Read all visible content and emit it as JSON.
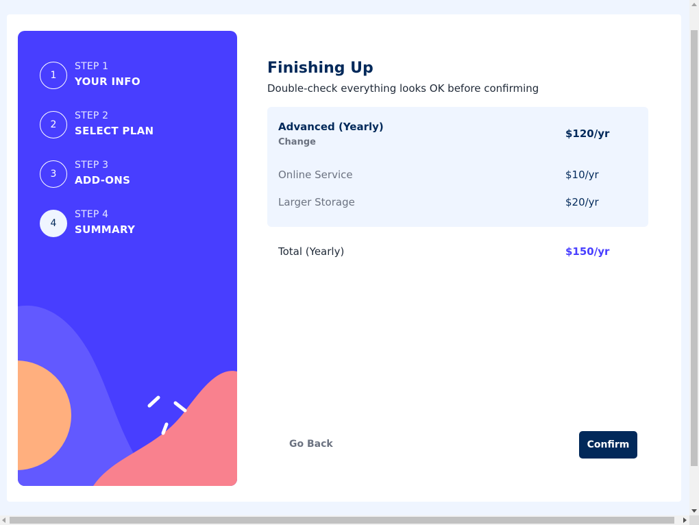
{
  "sidebar": {
    "steps": [
      {
        "number": "1",
        "label": "STEP 1",
        "title": "YOUR INFO",
        "active": false
      },
      {
        "number": "2",
        "label": "STEP 2",
        "title": "SELECT PLAN",
        "active": false
      },
      {
        "number": "3",
        "label": "STEP 3",
        "title": "ADD-ONS",
        "active": false
      },
      {
        "number": "4",
        "label": "STEP 4",
        "title": "SUMMARY",
        "active": true
      }
    ]
  },
  "main": {
    "title": "Finishing Up",
    "subtitle": "Double-check everything looks OK before confirming",
    "plan": {
      "name": "Advanced (Yearly)",
      "change_label": "Change",
      "price": "$120/yr"
    },
    "addons": [
      {
        "name": "Online Service",
        "price": "$10/yr"
      },
      {
        "name": "Larger Storage",
        "price": "$20/yr"
      }
    ],
    "total": {
      "label": "Total (Yearly)",
      "price": "$150/yr"
    },
    "buttons": {
      "back_label": "Go Back",
      "confirm_label": "Confirm"
    }
  },
  "colors": {
    "sidebar_bg": "#483eff",
    "marine_blue": "#02295a",
    "purplish_blue": "#483eff",
    "magnolia": "#eff5ff",
    "light_red": "#f9818e",
    "pastel_orange": "#ffaf7e"
  }
}
